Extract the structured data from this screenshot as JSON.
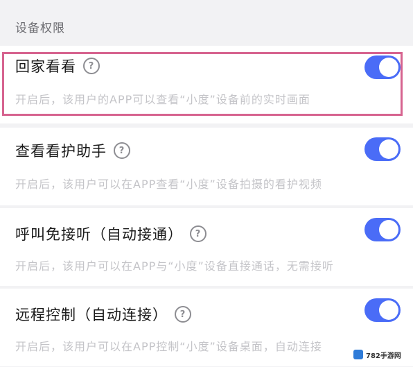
{
  "section_title": "设备权限",
  "items": [
    {
      "title": "回家看看",
      "help": "?",
      "desc": "开启后，该用户的APP可以查看“小度”设备前的实时画面",
      "enabled": true
    },
    {
      "title": "查看看护助手",
      "help": "?",
      "desc": "开启后，该用户可以在APP查看“小度”设备拍摄的看护视频",
      "enabled": true
    },
    {
      "title": "呼叫免接听（自动接通）",
      "help": "?",
      "desc": "开启后，该用户可以在APP与“小度”设备直接通话，无需接听",
      "enabled": true
    },
    {
      "title": "远程控制（自动连接）",
      "help": "?",
      "desc": "开启后，该用户可以在APP控制“小度”设备桌面，自动连接",
      "enabled": true
    }
  ],
  "colors": {
    "toggle_on": "#4a6cf7",
    "highlight": "#d6638f"
  },
  "watermark": {
    "text": "782手游网"
  }
}
